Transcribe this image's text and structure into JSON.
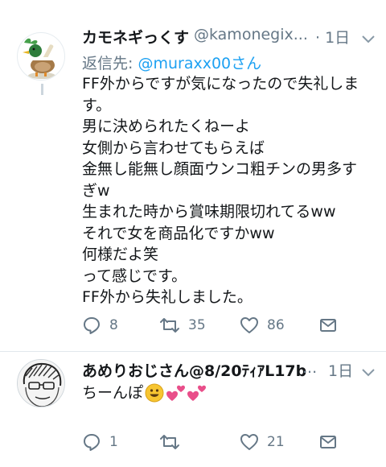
{
  "tweets": [
    {
      "name": "カモネギっくす",
      "handle": "@kamonegix...",
      "time": "· 1日",
      "replying_label": "返信先: ",
      "replying_to": "@muraxx00さん",
      "lines": [
        "FF外からですが気になったので失礼しま",
        "す。",
        "男に決められたくねーよ",
        "女側から言わせてもらえば",
        "金無し能無し顔面ウンコ粗チンの男多す",
        "ぎw",
        "生まれた時から賞味期限切れてるww",
        "それで女を商品化ですかww",
        "何様だよ笑",
        "って感じです。",
        "FF外から失礼しました。"
      ],
      "reply_count": "8",
      "retweet_count": "35",
      "like_count": "86"
    },
    {
      "name": "あめりおじさん@8/20ﾃｨｱL17b",
      "handle_ellipsis": "...",
      "time": "1日",
      "text": "ちーんぽ",
      "reply_count": "1",
      "retweet_count": "",
      "like_count": "21"
    }
  ],
  "colors": {
    "text": "#14171a",
    "secondary": "#657786",
    "link": "#1da1f2",
    "divider": "#e1e8ed",
    "heart_emoji": "#e94f8a",
    "smiley": "#f7c531"
  },
  "icons": [
    "duck-avatar",
    "sketch-face-avatar",
    "chevron-down-icon",
    "reply-icon",
    "retweet-icon",
    "like-icon",
    "share-mail-icon",
    "smiley-emoji",
    "two-hearts-emoji"
  ]
}
